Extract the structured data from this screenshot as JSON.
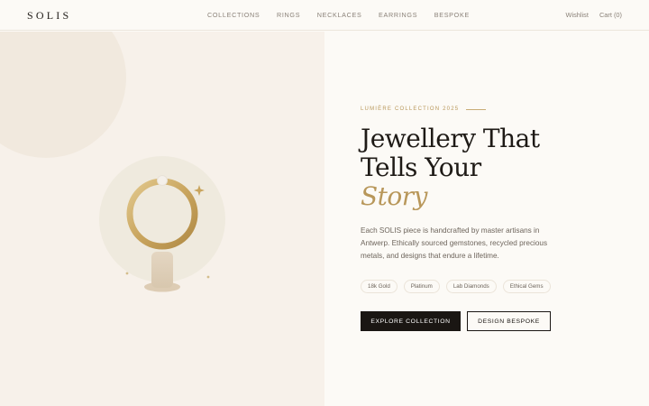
{
  "header": {
    "logo": "SOLIS",
    "nav": [
      "COLLECTIONS",
      "RINGS",
      "NECKLACES",
      "EARRINGS",
      "BESPOKE"
    ],
    "wishlist": "Wishlist",
    "cart": "Cart (0)"
  },
  "hero": {
    "eyebrow": "LUMIÈRE COLLECTION 2025",
    "headline_line1": "Jewellery That",
    "headline_line2": "Tells Your",
    "headline_accent": "Story",
    "description": "Each SOLIS piece is handcrafted by master artisans in Antwerp. Ethically sourced gemstones, recycled precious metals, and designs that endure a lifetime.",
    "tags": [
      "18k Gold",
      "Platinum",
      "Lab Diamonds",
      "Ethical Gems"
    ],
    "primary_button": "EXPLORE COLLECTION",
    "secondary_button": "DESIGN BESPOKE"
  },
  "colors": {
    "accent_gold": "#b8975a",
    "dark": "#1a1613",
    "hero_left_bg": "#f7f1ea",
    "page_bg": "#fcfaf6"
  },
  "icons": [
    "gold-ring-icon",
    "sparkle-icon"
  ]
}
